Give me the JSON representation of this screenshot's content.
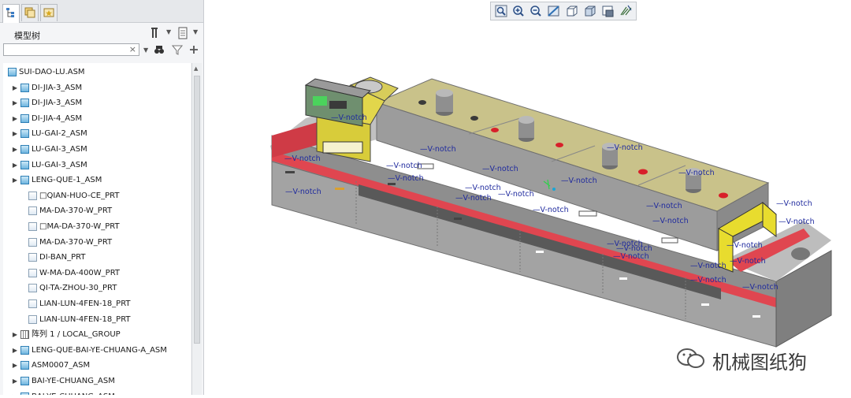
{
  "tree": {
    "title": "模型树",
    "items": [
      {
        "label": "SUI-DAO-LU.ASM",
        "type": "asm",
        "expander": ""
      },
      {
        "label": "DI-JIA-3_ASM",
        "type": "asm",
        "expander": "▶"
      },
      {
        "label": "DI-JIA-3_ASM",
        "type": "asm",
        "expander": "▶"
      },
      {
        "label": "DI-JIA-4_ASM",
        "type": "asm",
        "expander": "▶"
      },
      {
        "label": "LU-GAI-2_ASM",
        "type": "asm",
        "expander": "▶"
      },
      {
        "label": "LU-GAI-3_ASM",
        "type": "asm",
        "expander": "▶"
      },
      {
        "label": "LU-GAI-3_ASM",
        "type": "asm",
        "expander": "▶"
      },
      {
        "label": "LENG-QUE-1_ASM",
        "type": "asm",
        "expander": "▶"
      },
      {
        "label": "□QIAN-HUO-CE_PRT",
        "type": "prt",
        "expander": ""
      },
      {
        "label": "MA-DA-370-W_PRT",
        "type": "prt",
        "expander": ""
      },
      {
        "label": "□MA-DA-370-W_PRT",
        "type": "prt",
        "expander": ""
      },
      {
        "label": "MA-DA-370-W_PRT",
        "type": "prt",
        "expander": ""
      },
      {
        "label": "DI-BAN_PRT",
        "type": "prt",
        "expander": ""
      },
      {
        "label": "W-MA-DA-400W_PRT",
        "type": "prt",
        "expander": ""
      },
      {
        "label": "QI-TA-ZHOU-30_PRT",
        "type": "prt",
        "expander": ""
      },
      {
        "label": "LIAN-LUN-4FEN-18_PRT",
        "type": "prt",
        "expander": ""
      },
      {
        "label": "LIAN-LUN-4FEN-18_PRT",
        "type": "prt",
        "expander": ""
      },
      {
        "label": "阵列 1 / LOCAL_GROUP",
        "type": "grp",
        "expander": "▶"
      },
      {
        "label": "LENG-QUE-BAI-YE-CHUANG-A_ASM",
        "type": "asm",
        "expander": "▶"
      },
      {
        "label": "ASM0007_ASM",
        "type": "asm",
        "expander": "▶"
      },
      {
        "label": "BAI-YE-CHUANG_ASM",
        "type": "asm",
        "expander": "▶"
      },
      {
        "label": "BAI-YE-CHUANG_ASM",
        "type": "asm",
        "expander": "▶"
      }
    ]
  },
  "search": {
    "value": "",
    "clear": "×"
  },
  "icons": {
    "tabs": [
      "model-tree-icon",
      "layer-icon",
      "favorites-icon"
    ],
    "header": [
      "settings-icon",
      "show-icon"
    ],
    "search": [
      "find-icon",
      "filter-icon",
      "add-icon"
    ],
    "toolbar": [
      "refit-icon",
      "zoom-in-icon",
      "zoom-out-icon",
      "repaint-icon",
      "saved-views-icon",
      "display-style-icon",
      "perspective-icon",
      "datum-display-icon"
    ]
  },
  "viewport": {
    "notch_label": "V-notch",
    "colors": {
      "top": "#c9c28a",
      "body": "#9a9a9a",
      "red": "#e04650",
      "yellow": "#e8dc2e",
      "label": "#1f2a9e"
    }
  },
  "watermark": {
    "text": "机械图纸狗"
  }
}
